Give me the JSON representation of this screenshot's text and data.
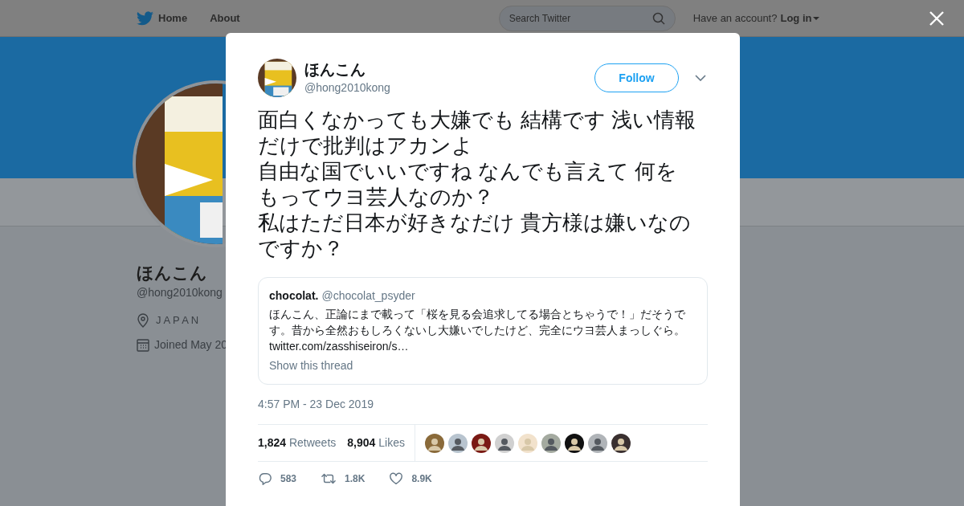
{
  "nav": {
    "items": [
      {
        "label": "Home"
      },
      {
        "label": "About"
      }
    ],
    "search": {
      "placeholder": "Search Twitter"
    },
    "account_prompt": "Have an account?",
    "login": "Log in"
  },
  "profile": {
    "name": "ほんこん",
    "handle": "@hong2010kong",
    "location": "J A P A N",
    "joined": "Joined May 20"
  },
  "tweet": {
    "author": {
      "name": "ほんこん",
      "handle": "@hong2010kong"
    },
    "follow_button": "Follow",
    "text_lines": [
      "面白くなかっても大嫌でも 結構です 浅い情報だけで批判はアカンよ",
      "自由な国でいいですね なんでも言えて 何をもってウヨ芸人なのか？",
      "私はただ日本が好きなだけ 貴方様は嫌いなのですか？"
    ],
    "quoted": {
      "name": "chocolat.",
      "handle": "@chocolat_psyder",
      "text": "ほんこん、正論にまで載って「桜を見る会追求してる場合とちゃうで！」だそうです。昔から全然おもしろくないし大嫌いでしたけど、完全にウヨ芸人まっしぐら。",
      "link": "twitter.com/zasshiseiron/s…",
      "thread_link": "Show this thread"
    },
    "timestamp": "4:57 PM - 23 Dec 2019",
    "stats": [
      {
        "count": "1,824",
        "label": "Retweets"
      },
      {
        "count": "8,904",
        "label": "Likes"
      }
    ],
    "actions": [
      {
        "kind": "reply",
        "count": "583"
      },
      {
        "kind": "retweet",
        "count": "1.8K"
      },
      {
        "kind": "like",
        "count": "8.9K"
      }
    ]
  }
}
